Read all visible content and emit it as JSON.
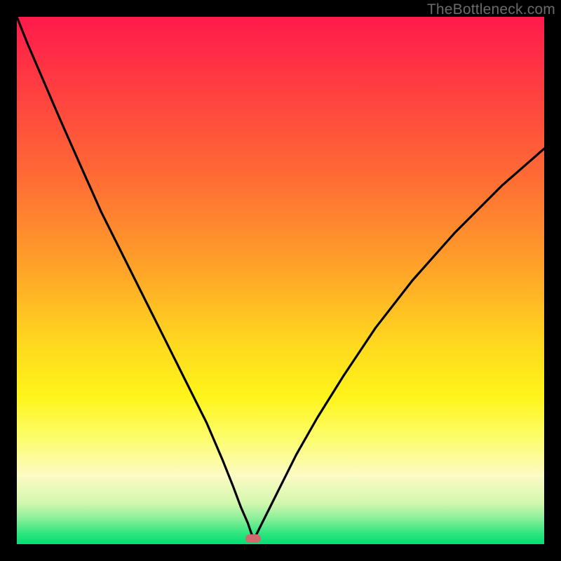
{
  "watermark": "TheBottleneck.com",
  "chart_data": {
    "type": "line",
    "title": "",
    "xlabel": "",
    "ylabel": "",
    "xlim": [
      0,
      100
    ],
    "ylim": [
      0,
      100
    ],
    "grid": false,
    "legend": false,
    "series": [
      {
        "name": "bottleneck-curve",
        "x": [
          0,
          2,
          5,
          8,
          12,
          16,
          20,
          24,
          28,
          32,
          36,
          39,
          41,
          42.5,
          43.8,
          44.5,
          45,
          45.5,
          46.5,
          48,
          50,
          53,
          57,
          62,
          68,
          75,
          83,
          92,
          100
        ],
        "y": [
          100,
          95,
          88,
          81,
          72,
          63,
          55,
          47,
          39,
          31,
          23,
          16,
          11,
          7,
          4,
          2,
          1,
          2,
          4,
          7,
          11,
          17,
          24,
          32,
          41,
          50,
          59,
          68,
          75
        ]
      }
    ],
    "annotations": [
      {
        "name": "optimal-marker",
        "x": 44.8,
        "y": 1
      }
    ],
    "background_gradient": {
      "top": "#ff1a4b",
      "mid": "#ffd81f",
      "bottom": "#05de73"
    }
  }
}
